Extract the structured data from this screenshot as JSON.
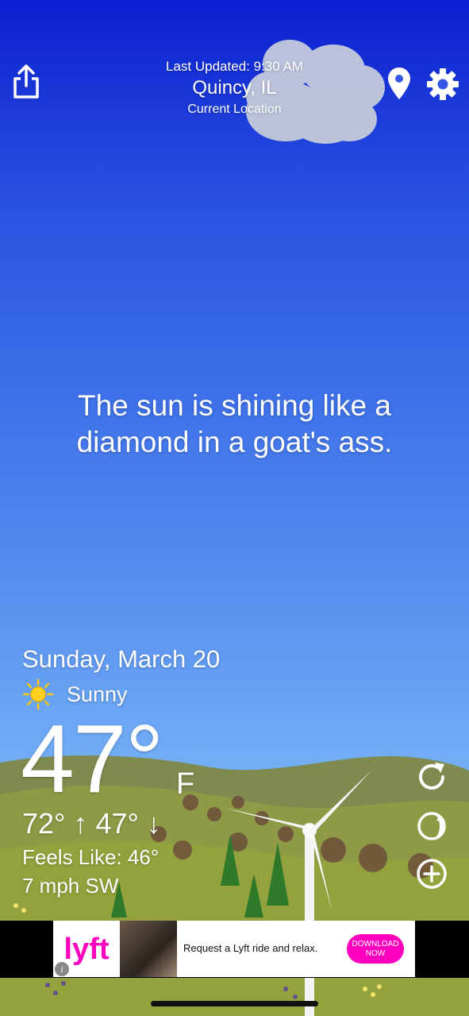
{
  "header": {
    "last_updated": "Last Updated: 9:30 AM",
    "city": "Quincy, IL",
    "location_label": "Current Location"
  },
  "quote": {
    "line1": "The sun is shining like a",
    "line2": "diamond in a goat's ass."
  },
  "weather": {
    "date": "Sunday, March 20",
    "condition": "Sunny",
    "temperature": "47°",
    "unit": "F",
    "hi_lo": "72° ↑ 47° ↓",
    "feels_like": "Feels Like: 46°",
    "wind": "7 mph SW"
  },
  "ad": {
    "brand": "lyft",
    "text": "Request a Lyft ride and relax.",
    "button_line1": "DOWNLOAD",
    "button_line2": "NOW",
    "info": "i"
  },
  "colors": {
    "sky_top": "#0b1fd0",
    "sky_bottom": "#86c2f7",
    "lyft_pink": "#ff00bf",
    "grass": "#8a9a3e"
  },
  "icons": {
    "share": "share-icon",
    "location": "location-pin-icon",
    "settings": "gear-icon",
    "refresh": "refresh-icon",
    "moon": "moon-phase-icon",
    "add": "add-circle-icon",
    "sun": "sun-icon"
  }
}
